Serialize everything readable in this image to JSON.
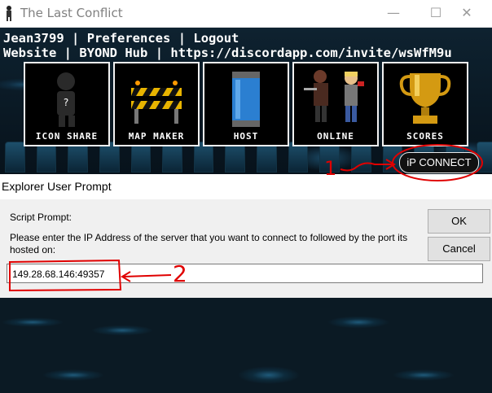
{
  "window": {
    "title": "The Last Conflict",
    "minimize": "—",
    "maximize": "☐",
    "close": "✕"
  },
  "links": {
    "row1": [
      "Jean3799",
      "Preferences",
      "Logout"
    ],
    "row2": [
      "Website",
      "BYOND Hub",
      "https://discordapp.com/invite/wsWfM9u"
    ],
    "separator": "|"
  },
  "tiles": [
    {
      "label": "Icon Share",
      "icon": "silhouette-icon"
    },
    {
      "label": "Map Maker",
      "icon": "construction-barrier-icon"
    },
    {
      "label": "Host",
      "icon": "capsule-tube-icon"
    },
    {
      "label": "Online",
      "icon": "characters-icon"
    },
    {
      "label": "Scores",
      "icon": "trophy-icon"
    }
  ],
  "ip_connect": {
    "label": "iP CONNECT"
  },
  "prompt": {
    "title": "Explorer User Prompt",
    "script_label": "Script Prompt:",
    "message": "Please enter the IP Address of the server that you want to connect to followed by the port its hosted on:",
    "input_value": "149.28.68.146:49357",
    "ok_label": "OK",
    "cancel_label": "Cancel"
  },
  "annotations": {
    "mark1": "1",
    "mark2": "2",
    "color": "#e00000"
  }
}
